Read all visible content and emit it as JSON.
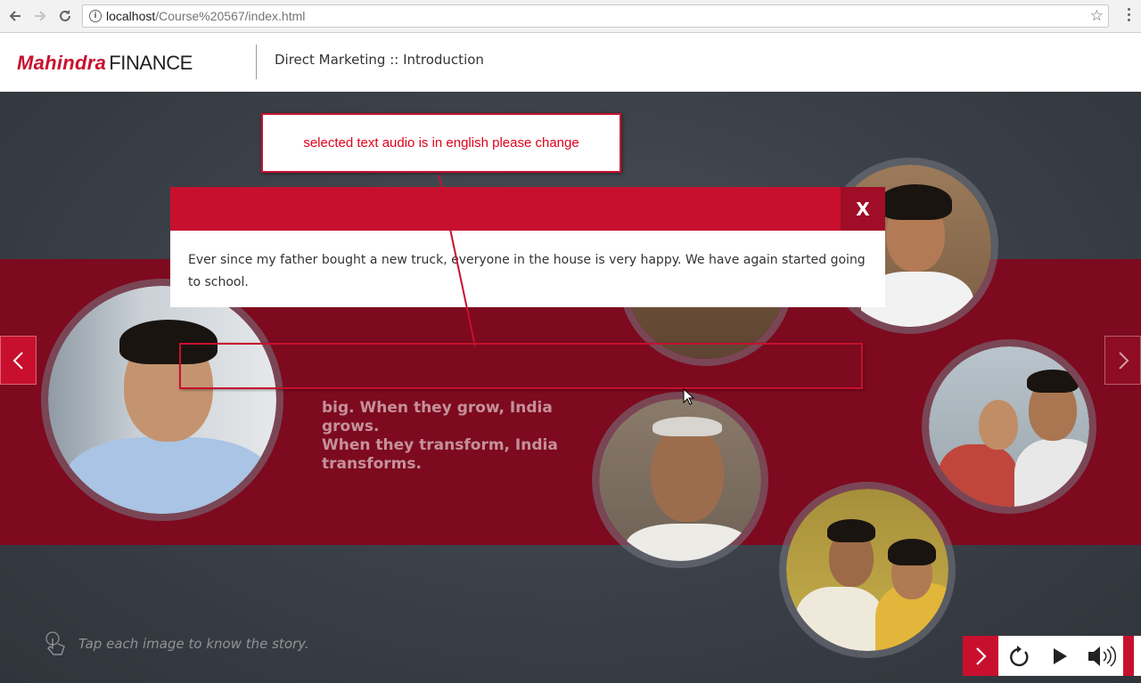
{
  "browser": {
    "url_host": "localhost",
    "url_path": "/Course%20567/index.html"
  },
  "header": {
    "logo_brand": "Mahindra",
    "logo_sub": "FINANCE",
    "course_title": "Direct Marketing :: Introduction"
  },
  "stage": {
    "band_lines": [
      "big. When they grow, India grows.",
      "When they transform, India",
      "transforms."
    ],
    "tap_hint": "Tap each image to know the story."
  },
  "popup": {
    "close_label": "X",
    "story_text": "Ever since my father bought a new truck, everyone in the house is very happy. We have again started going to school."
  },
  "annotation": {
    "comment": "selected text audio is in english please change"
  },
  "controls": {
    "items": [
      "next-icon",
      "replay-icon",
      "play-icon",
      "volume-icon"
    ]
  },
  "colors": {
    "brand_red": "#c8102e",
    "band": "#7d0a1f",
    "stage": "#3a3f47"
  }
}
